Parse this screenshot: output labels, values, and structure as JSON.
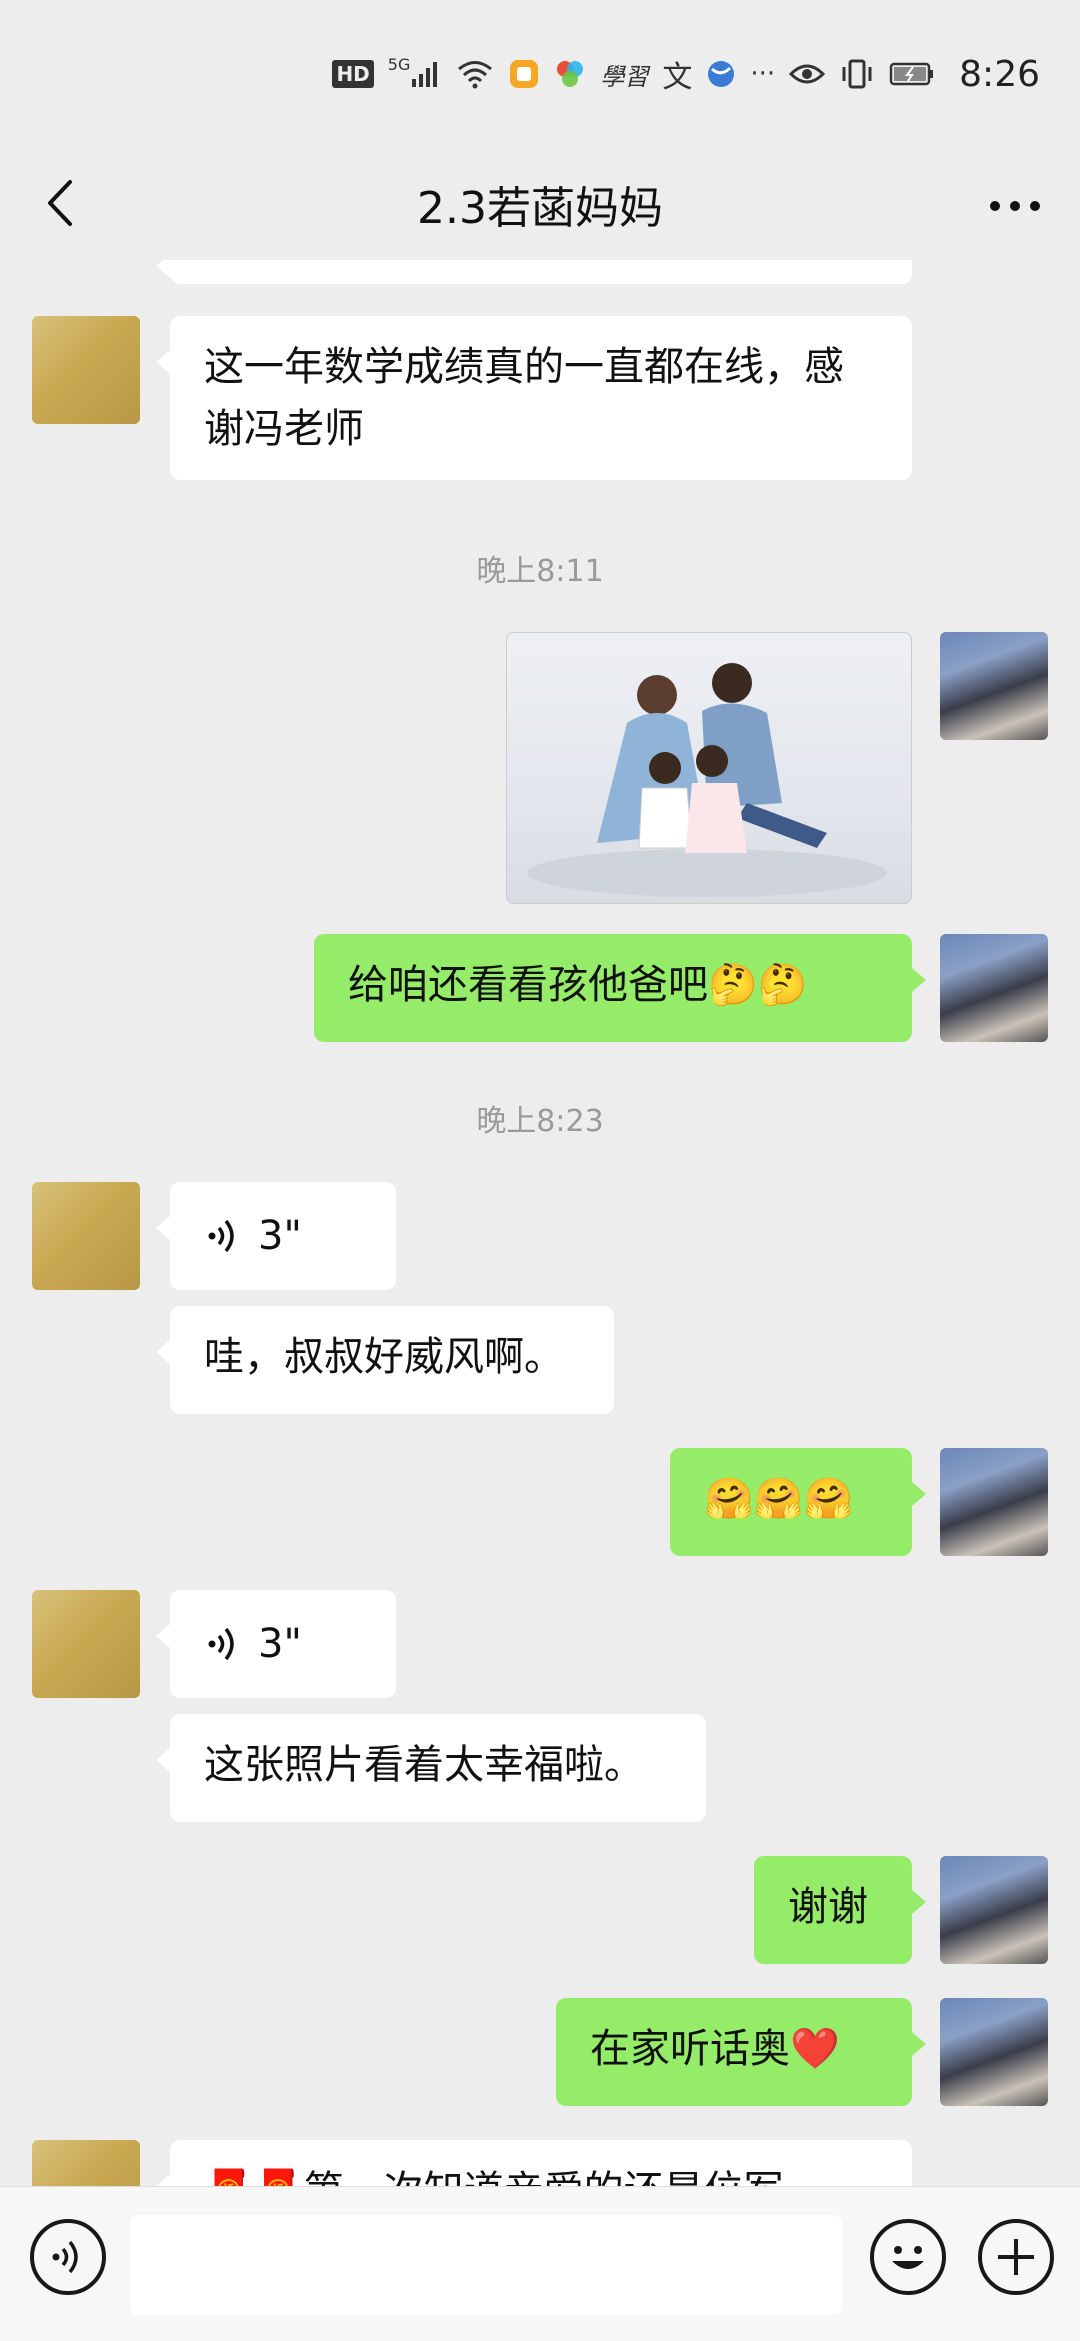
{
  "status_bar": {
    "time": "8:26",
    "hd": "HD",
    "network": "5G",
    "study_text": "學習",
    "wen_text": "文",
    "dots": "···"
  },
  "header": {
    "title": "2.3若菡妈妈"
  },
  "messages": {
    "m1_text": "这一年数学成绩真的一直都在线，感谢冯老师",
    "time1": "晚上8:11",
    "m3_text": "给咱还看看孩他爸吧🤔🤔",
    "time2": "晚上8:23",
    "m4_voice": "3\"",
    "m5_text": "哇，叔叔好威风啊。",
    "m6_text": "🤗🤗🤗",
    "m7_voice": "3\"",
    "m8_text": "这张照片看着太幸福啦。",
    "m9_text": "谢谢",
    "m10_text": "在家听话奥❤️",
    "m11_text": "🧧🧧第一次知道亲爱的还是位军"
  },
  "input": {
    "placeholder": ""
  },
  "colors": {
    "chat_bg": "#ededed",
    "outgoing_bubble": "#95ec69",
    "incoming_bubble": "#ffffff"
  }
}
